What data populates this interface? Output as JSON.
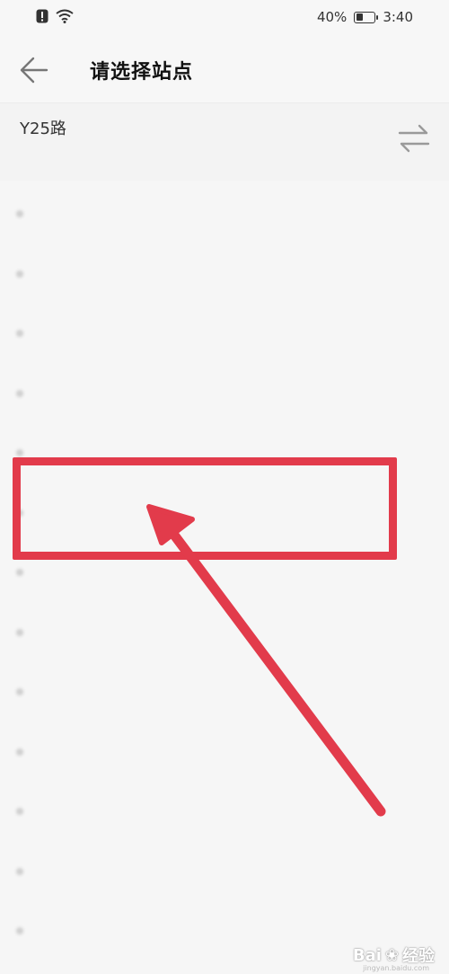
{
  "status_bar": {
    "battery_text": "40%",
    "battery_level": 0.4,
    "time": "3:40"
  },
  "header": {
    "title": "请选择站点"
  },
  "route": {
    "name": "Y25路",
    "direction": "",
    "swap_icon": "swap-direction-icon"
  },
  "stops": [
    {
      "label": ""
    },
    {
      "label": ""
    },
    {
      "label": ""
    },
    {
      "label": ""
    },
    {
      "label": ""
    },
    {
      "label": ""
    },
    {
      "label": ""
    },
    {
      "label": ""
    },
    {
      "label": ""
    },
    {
      "label": ""
    },
    {
      "label": ""
    },
    {
      "label": ""
    },
    {
      "label": ""
    }
  ],
  "annotation": {
    "color": "#e23b4b"
  },
  "watermark": {
    "brand": "Bai",
    "brand2": "经验",
    "url": "jingyan.baidu.com"
  }
}
